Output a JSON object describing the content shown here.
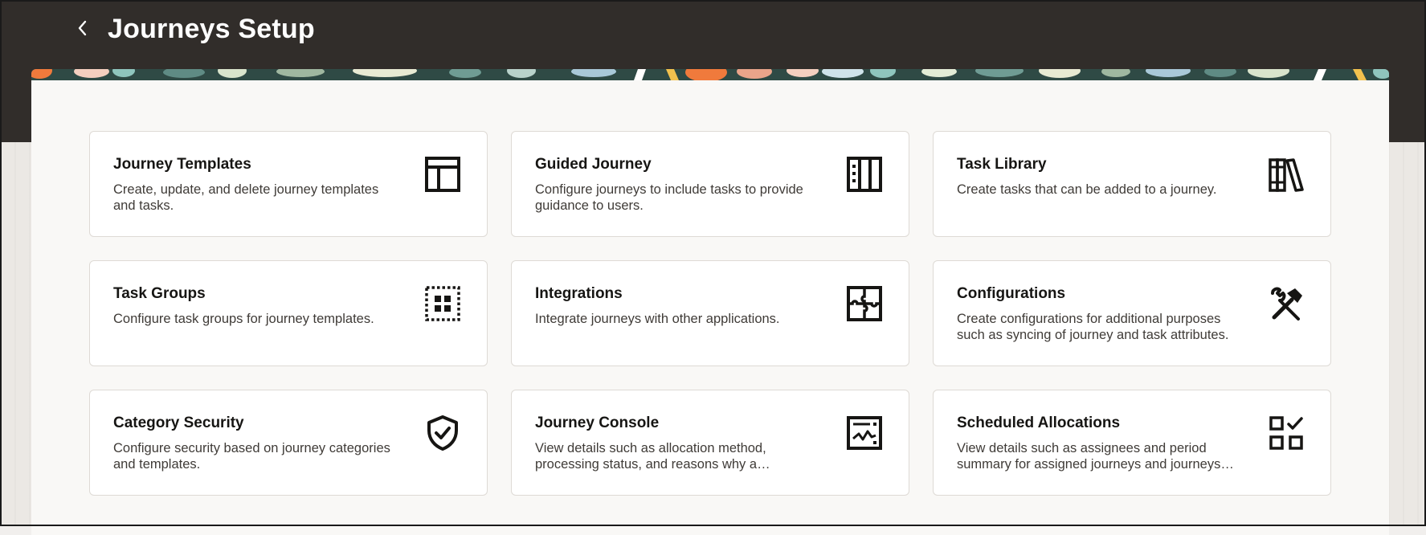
{
  "header": {
    "title": "Journeys Setup"
  },
  "cards": [
    {
      "title": "Journey Templates",
      "description": "Create, update, and delete journey templates and tasks.",
      "icon": "layout-template-icon"
    },
    {
      "title": "Guided Journey",
      "description": "Configure journeys to include tasks to provide guidance to users.",
      "icon": "columns-list-icon"
    },
    {
      "title": "Task Library",
      "description": "Create tasks that can be added to a journey.",
      "icon": "books-library-icon"
    },
    {
      "title": "Task Groups",
      "description": "Configure task groups for journey templates.",
      "icon": "grid-group-icon"
    },
    {
      "title": "Integrations",
      "description": "Integrate journeys with other applications.",
      "icon": "puzzle-icon"
    },
    {
      "title": "Configurations",
      "description": "Create configurations for additional purposes such as syncing of journey and task attributes.",
      "icon": "tools-icon"
    },
    {
      "title": "Category Security",
      "description": "Configure security based on journey categories and templates.",
      "icon": "shield-check-icon"
    },
    {
      "title": "Journey Console",
      "description": "View details such as allocation method, processing status, and reasons why a journey…",
      "icon": "console-chart-icon"
    },
    {
      "title": "Scheduled Allocations",
      "description": "View details such as assignees and period summary for assigned journeys and journeys…",
      "icon": "schedule-checklist-icon"
    }
  ],
  "colors": {
    "header_bg": "#312d2a",
    "panel_bg": "#f9f8f6",
    "card_bg": "#ffffff",
    "text": "#161513"
  }
}
